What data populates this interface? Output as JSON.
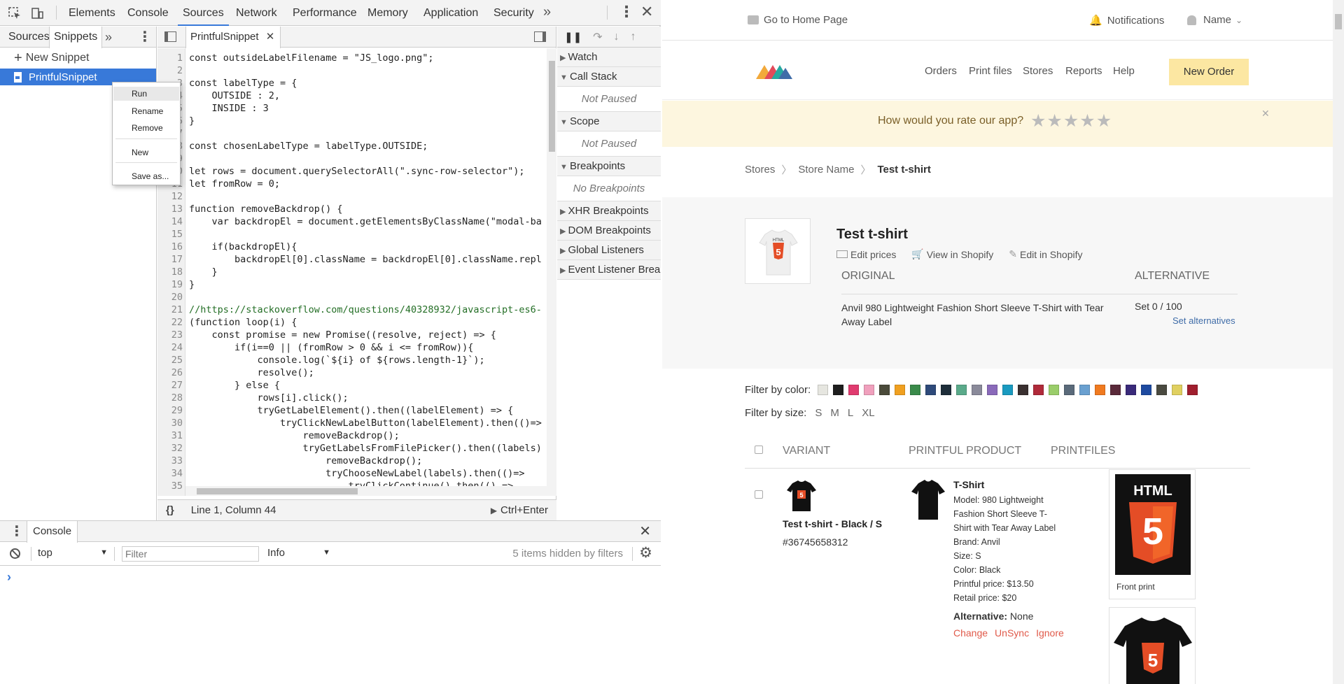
{
  "devtools": {
    "tabs": [
      "Elements",
      "Console",
      "Sources",
      "Network",
      "Performance",
      "Memory",
      "Application",
      "Security"
    ],
    "active_tab": "Sources",
    "navigator": {
      "tabs": [
        "Sources",
        "Snippets"
      ],
      "active_tab": "Snippets",
      "new_snippet": "New Snippet",
      "snippet_name": "PrintfulSnippet"
    },
    "context_menu": [
      "Run",
      "Rename",
      "Remove",
      "New",
      "Save as..."
    ],
    "editor": {
      "file_tab": "PrintfulSnippet",
      "lines": [
        "const outsideLabelFilename = \"JS_logo.png\";",
        "",
        "const labelType = {",
        "    OUTSIDE : 2,",
        "    INSIDE : 3",
        "}",
        "",
        "const chosenLabelType = labelType.OUTSIDE;",
        "",
        "let rows = document.querySelectorAll(\".sync-row-selector\");",
        "let fromRow = 0;",
        "",
        "function removeBackdrop() {",
        "    var backdropEl = document.getElementsByClassName(\"modal-ba",
        "",
        "    if(backdropEl){",
        "        backdropEl[0].className = backdropEl[0].className.repl",
        "    }",
        "}",
        "",
        "//https://stackoverflow.com/questions/40328932/javascript-es6-",
        "(function loop(i) {",
        "    const promise = new Promise((resolve, reject) => {",
        "        if(i==0 || (fromRow > 0 && i <= fromRow)){",
        "            console.log(`${i} of ${rows.length-1}`);",
        "            resolve();",
        "        } else {",
        "            rows[i].click();",
        "            tryGetLabelElement().then((labelElement) => {",
        "                tryClickNewLabelButton(labelElement).then(()=>",
        "                    removeBackdrop();",
        "                    tryGetLabelsFromFilePicker().then((labels)",
        "                        removeBackdrop();",
        "                        tryChooseNewLabel(labels).then(()=>",
        "                            tryClickContinue().then(() =>"
      ],
      "status_position": "Line 1, Column 44",
      "run_hint": "Ctrl+Enter"
    },
    "debugger": {
      "watch": "Watch",
      "call_stack": "Call Stack",
      "not_paused": "Not Paused",
      "scope": "Scope",
      "breakpoints": "Breakpoints",
      "no_breakpoints": "No Breakpoints",
      "xhr": "XHR Breakpoints",
      "dom": "DOM Breakpoints",
      "global": "Global Listeners",
      "event": "Event Listener Breakpoints"
    },
    "console": {
      "tab": "Console",
      "context": "top",
      "filter_placeholder": "Filter",
      "level": "Info",
      "hidden": "5 items hidden by filters",
      "prompt": "›"
    }
  },
  "page": {
    "topbar": {
      "home": "Go to Home Page",
      "notifications": "Notifications",
      "user": "Name"
    },
    "nav": [
      "Orders",
      "Print files",
      "Stores",
      "Reports",
      "Help"
    ],
    "new_order": "New Order",
    "rating": {
      "question": "How would you rate our app?",
      "stars": 5,
      "filled": 0
    },
    "breadcrumb": [
      "Stores",
      "Store Name",
      "Test t-shirt"
    ],
    "product": {
      "title": "Test t-shirt",
      "actions": [
        "Edit prices",
        "View in Shopify",
        "Edit in Shopify"
      ],
      "col_original": "ORIGINAL",
      "col_alternative": "ALTERNATIVE",
      "original_desc": "Anvil 980 Lightweight Fashion Short Sleeve T-Shirt with Tear Away Label",
      "set_count": "Set 0 / 100",
      "set_alternatives": "Set alternatives"
    },
    "filters": {
      "color_label": "Filter by color:",
      "colors": [
        "#e6e6e0",
        "#1e1e1e",
        "#e03b6f",
        "#f0a0bd",
        "#4a4a3a",
        "#f0a020",
        "#3a8a4a",
        "#2e4a7a",
        "#1e2e3a",
        "#5aaa8a",
        "#8a8a9a",
        "#8a6aba",
        "#1a9ac0",
        "#3a3030",
        "#b02a3a",
        "#9acd6a",
        "#5a6a7a",
        "#6aa0d0",
        "#f07a20",
        "#5a2a3a",
        "#3a2a7a",
        "#1e4aa0",
        "#4a4a40",
        "#e0d060",
        "#a01e2e"
      ],
      "size_label": "Filter by size:",
      "sizes": [
        "S",
        "M",
        "L",
        "XL"
      ]
    },
    "table": {
      "headers": [
        "VARIANT",
        "PRINTFUL PRODUCT",
        "PRINTFILES"
      ],
      "variant_name": "Test t-shirt - Black / S",
      "variant_id": "#36745658312",
      "product_name": "T-Shirt",
      "details": [
        "Model: 980 Lightweight",
        "Fashion Short Sleeve T-",
        "Shirt with Tear Away Label",
        "Brand: Anvil",
        "Size: S",
        "Color: Black",
        "Printful price: $13.50",
        "Retail price: $20"
      ],
      "alternative_label": "Alternative:",
      "alternative_value": "None",
      "links": [
        "Change",
        "UnSync",
        "Ignore"
      ],
      "printfile_label": "Front print",
      "html_badge": "HTML",
      "html_digit": "5"
    }
  }
}
